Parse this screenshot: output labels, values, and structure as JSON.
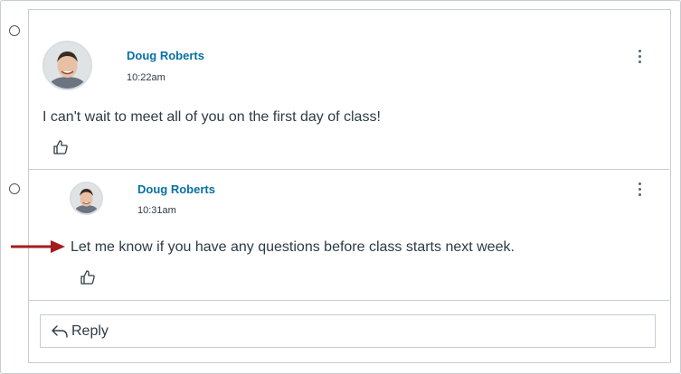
{
  "entries": [
    {
      "author": "Doug Roberts",
      "time": "10:22am",
      "message": "I can't wait to meet all of you on the first day of class!"
    },
    {
      "author": "Doug Roberts",
      "time": "10:31am",
      "message": "Let me know if you have any questions before class starts next week."
    }
  ],
  "reply": {
    "label": "Reply"
  },
  "colors": {
    "author": "#0770a3",
    "arrow": "#a31c1c",
    "border": "#c7cdd1",
    "text": "#2d3b45"
  },
  "icons": [
    "radio-icon",
    "avatar",
    "more-options-icon",
    "like-icon",
    "reply-icon",
    "annotation-arrow"
  ]
}
